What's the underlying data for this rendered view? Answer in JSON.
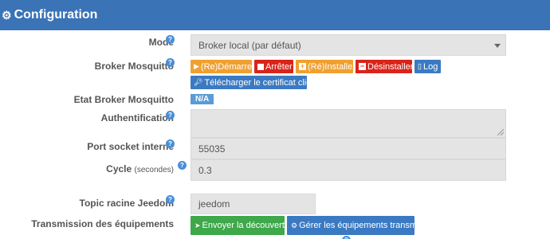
{
  "header": {
    "title": "Configuration",
    "icon": "gear-icon"
  },
  "mode": {
    "label": "Mode",
    "value": "Broker local (par défaut)"
  },
  "broker": {
    "label": "Broker Mosquitto",
    "buttons": {
      "restart": "(Re)Démarrer",
      "stop": "Arrêter",
      "reinstall": "(Ré)Installer",
      "uninstall": "Désinstaller",
      "log": "Log",
      "download_cert": "Télécharger le certificat client"
    }
  },
  "status": {
    "label": "Etat Broker Mosquitto",
    "value": "N/A"
  },
  "auth": {
    "label": "Authentification",
    "value": ""
  },
  "port": {
    "label": "Port socket interne",
    "value": "55035"
  },
  "cycle": {
    "label": "Cycle",
    "unit": "(secondes)",
    "value": "0.3"
  },
  "topic": {
    "label": "Topic racine Jeedom",
    "value": "jeedom"
  },
  "transmission": {
    "label": "Transmission des équipements",
    "send_discovery": "Envoyer la découverte",
    "manage": "Gérer les équipements transmis"
  },
  "colors": {
    "header": "#3a73b6",
    "orange": "#f0a030",
    "red": "#d9241a",
    "blue": "#3b7ac2",
    "green": "#3ea84a"
  }
}
